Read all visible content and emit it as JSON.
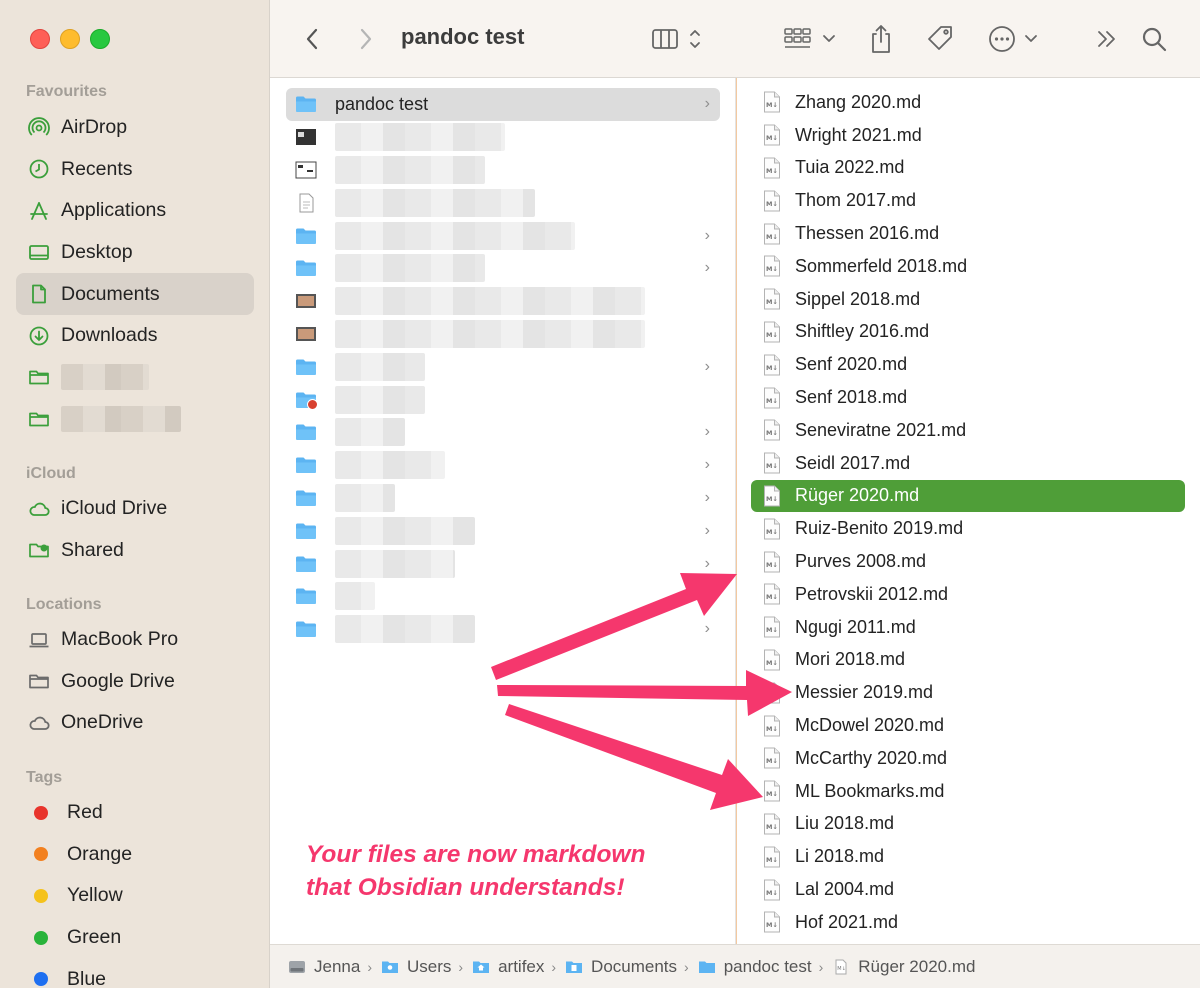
{
  "window": {
    "title": "pandoc test"
  },
  "sidebar": {
    "favourites_heading": "Favourites",
    "favourites": [
      {
        "label": "AirDrop",
        "icon": "airdrop-icon"
      },
      {
        "label": "Recents",
        "icon": "clock-icon"
      },
      {
        "label": "Applications",
        "icon": "applications-icon"
      },
      {
        "label": "Desktop",
        "icon": "desktop-icon"
      },
      {
        "label": "Documents",
        "icon": "document-icon",
        "selected": true
      },
      {
        "label": "Downloads",
        "icon": "download-icon"
      }
    ],
    "icloud_heading": "iCloud",
    "icloud": [
      {
        "label": "iCloud Drive",
        "icon": "cloud-icon"
      },
      {
        "label": "Shared",
        "icon": "shared-folder-icon"
      }
    ],
    "locations_heading": "Locations",
    "locations": [
      {
        "label": "MacBook Pro",
        "icon": "laptop-icon"
      },
      {
        "label": "Google Drive",
        "icon": "folder-icon"
      },
      {
        "label": "OneDrive",
        "icon": "cloud-icon"
      }
    ],
    "tags_heading": "Tags",
    "tags": [
      {
        "label": "Red",
        "color": "#e8342c"
      },
      {
        "label": "Orange",
        "color": "#f2801f"
      },
      {
        "label": "Yellow",
        "color": "#f5c21b"
      },
      {
        "label": "Green",
        "color": "#29b33a"
      },
      {
        "label": "Blue",
        "color": "#1e6ff0"
      }
    ]
  },
  "column1": {
    "selected_folder": "pandoc test"
  },
  "column2": {
    "files": [
      "Zhang 2020.md",
      "Wright 2021.md",
      "Tuia 2022.md",
      "Thom 2017.md",
      "Thessen 2016.md",
      "Sommerfeld 2018.md",
      "Sippel 2018.md",
      "Shiftley 2016.md",
      "Senf 2020.md",
      "Senf 2018.md",
      "Seneviratne 2021.md",
      "Seidl 2017.md",
      "Rüger 2020.md",
      "Ruiz-Benito 2019.md",
      "Purves 2008.md",
      "Petrovskii 2012.md",
      "Ngugi 2011.md",
      "Mori 2018.md",
      "Messier 2019.md",
      "McDowel 2020.md",
      "McCarthy 2020.md",
      "ML Bookmarks.md",
      "Liu 2018.md",
      "Li 2018.md",
      "Lal 2004.md",
      "Hof 2021.md"
    ],
    "selected_file": "Rüger 2020.md"
  },
  "annotation": {
    "line1": "Your files are now markdown",
    "line2": "that Obsidian understands!",
    "color": "#f5376d"
  },
  "pathbar": {
    "items": [
      "Jenna",
      "Users",
      "artifex",
      "Documents",
      "pandoc test",
      "Rüger 2020.md"
    ]
  },
  "colors": {
    "sidebar_bg": "#ece4da",
    "selection_green": "#4f9e38",
    "folder_blue": "#5cb4f2"
  }
}
